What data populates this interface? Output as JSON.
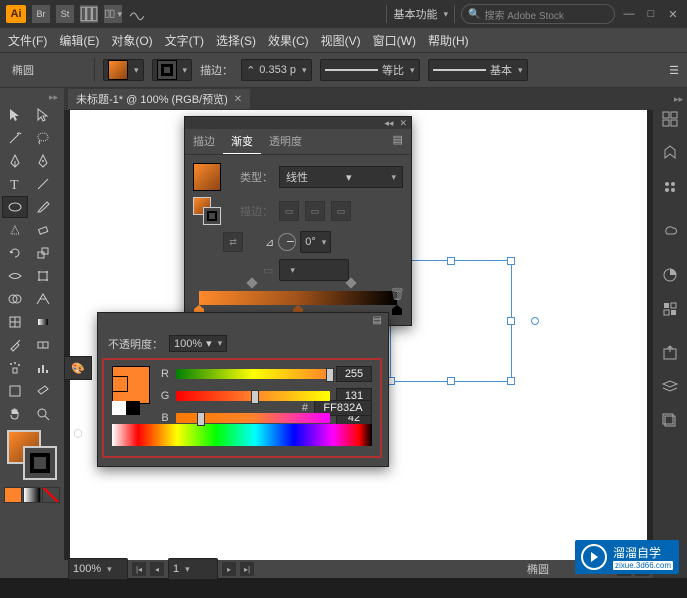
{
  "app": {
    "logo": "Ai",
    "bridge": "Br",
    "stock": "St"
  },
  "workspace": "基本功能",
  "search_placeholder": "搜索 Adobe Stock",
  "menu": [
    "文件(F)",
    "编辑(E)",
    "对象(O)",
    "文字(T)",
    "选择(S)",
    "效果(C)",
    "视图(V)",
    "窗口(W)",
    "帮助(H)"
  ],
  "options": {
    "shape": "椭圆",
    "stroke_label": "描边：",
    "stroke_weight": "0.353 p",
    "uniform": "等比",
    "style": "基本"
  },
  "doc_tab": "未标题-1* @ 100% (RGB/预览)",
  "gradient_panel": {
    "tabs": [
      "描边",
      "渐变",
      "透明度"
    ],
    "active_tab": 1,
    "type_label": "类型：",
    "type_value": "线性",
    "stroke_label": "描边：",
    "angle_value": "0°",
    "aspect_value": "",
    "stops": [
      0,
      50,
      100
    ]
  },
  "color_panel": {
    "opacity_label": "不透明度：",
    "opacity_value": "100%",
    "R_label": "R",
    "R_value": "255",
    "G_label": "G",
    "G_value": "131",
    "B_label": "B",
    "B_value": "42",
    "hex_prefix": "#",
    "hex_value": "FF832A"
  },
  "status": {
    "zoom": "100%",
    "page": "1",
    "tool": "椭圆"
  },
  "badge": {
    "brand": "溜溜自学",
    "url": "zixue.3d66.com"
  },
  "chart_data": null
}
